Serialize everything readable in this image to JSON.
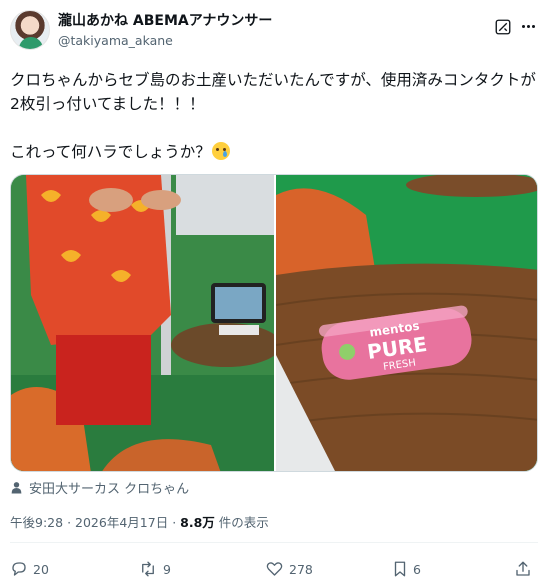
{
  "author": {
    "display_name": "瀧山あかね ABEMAアナウンサー",
    "handle": "@takiyama_akane"
  },
  "tweet": {
    "line1": "クロちゃんからセブ島のお土産いただいたんですが、使用済みコンタクトが2枚引っ付いてました！！！",
    "line2": "これって何ハラでしょうか？"
  },
  "photos": {
    "right_product": {
      "brand": "mentos",
      "name": "PURE",
      "sub": "FRESH",
      "colors": {
        "pack": "#e8739e",
        "label": "#ffffff"
      }
    }
  },
  "tagged": {
    "label": "安田大サーカス クロちゃん"
  },
  "meta": {
    "time": "午後9:28",
    "separator": "·",
    "date": "2026年4月17日",
    "views": "8.8万",
    "views_suffix": "件の表示"
  },
  "actions": {
    "replies": "20",
    "reposts": "9",
    "likes": "278",
    "bookmarks": "6"
  },
  "icons": [
    "grok-icon",
    "more-icon",
    "person-icon",
    "reply-icon",
    "repost-icon",
    "like-icon",
    "bookmark-icon",
    "share-icon"
  ],
  "colors": {
    "text": "#0f1419",
    "secondary": "#536471",
    "border": "#cfd9de"
  }
}
